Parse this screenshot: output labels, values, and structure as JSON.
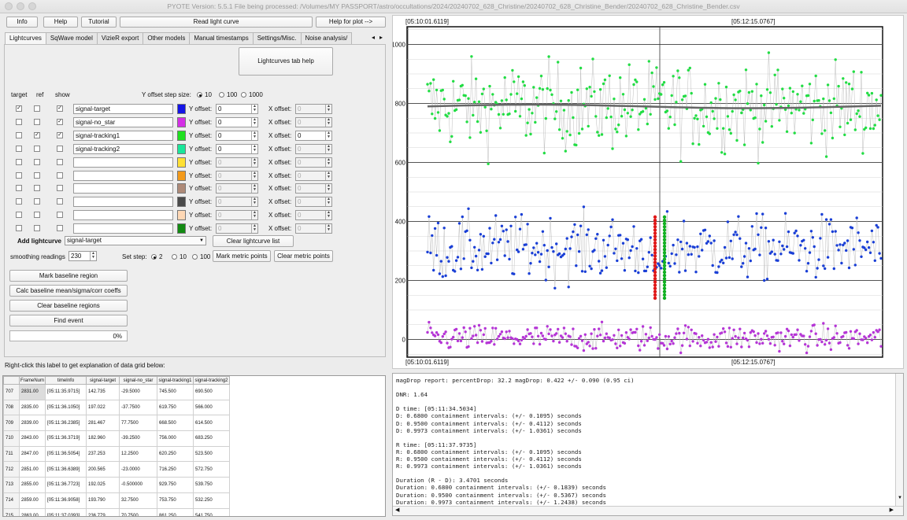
{
  "window": {
    "title": "PYOTE Version: 5.5.1  File being processed: /Volumes/MY PASSPORT/astro/occultations/2024/20240702_628_Christine/20240702_628_Christine_Bender/20240702_628_Christine_Bender.csv"
  },
  "toolbar": {
    "info": "Info",
    "help": "Help",
    "tutorial": "Tutorial",
    "read": "Read light curve",
    "help_plot": "Help for plot -->"
  },
  "tabs": [
    "Lightcurves",
    "SqWave model",
    "VizieR export",
    "Other models",
    "Manual timestamps",
    "Settings/Misc.",
    "Noise analysis/"
  ],
  "lc_help": "Lightcurves tab help",
  "columns": {
    "target": "target",
    "ref": "ref",
    "show": "show"
  },
  "yoffset": {
    "label": "Y offset step size:",
    "opts": [
      "10",
      "100",
      "1000"
    ],
    "selected": "10"
  },
  "offset_labels": {
    "y": "Y offset:",
    "x": "X offset:"
  },
  "rows": [
    {
      "name": "signal-target",
      "color": "#1414e6",
      "target": true,
      "ref": false,
      "show": true,
      "y": "0",
      "x": "0"
    },
    {
      "name": "signal-no_star",
      "color": "#d42fe6",
      "target": false,
      "ref": false,
      "show": true,
      "y": "0",
      "x": "0"
    },
    {
      "name": "signal-tracking1",
      "color": "#1fe01f",
      "target": false,
      "ref": true,
      "show": true,
      "y": "0",
      "x": "0"
    },
    {
      "name": "signal-tracking2",
      "color": "#1ae69a",
      "target": false,
      "ref": false,
      "show": false,
      "y": "0",
      "x": "0"
    },
    {
      "name": "",
      "color": "#ffe033",
      "target": false,
      "ref": false,
      "show": false,
      "y": "0",
      "x": "0"
    },
    {
      "name": "",
      "color": "#f39a1a",
      "target": false,
      "ref": false,
      "show": false,
      "y": "0",
      "x": "0"
    },
    {
      "name": "",
      "color": "#ae8a78",
      "target": false,
      "ref": false,
      "show": false,
      "y": "0",
      "x": "0"
    },
    {
      "name": "",
      "color": "#4a4a4a",
      "target": false,
      "ref": false,
      "show": false,
      "y": "0",
      "x": "0"
    },
    {
      "name": "",
      "color": "#ffd8b5",
      "target": false,
      "ref": false,
      "show": false,
      "y": "0",
      "x": "0"
    },
    {
      "name": "",
      "color": "#128a12",
      "target": false,
      "ref": false,
      "show": false,
      "y": "0",
      "x": "0"
    }
  ],
  "add_lc": {
    "label": "Add lightcurve",
    "value": "signal-target",
    "clear": "Clear lightcurve list"
  },
  "smoothing": {
    "label": "smoothing readings",
    "value": "230"
  },
  "setstep": {
    "label": "Set step:",
    "opts": [
      "2",
      "10",
      "100"
    ],
    "selected": "2"
  },
  "metric": {
    "mark": "Mark metric points",
    "clear": "Clear metric points"
  },
  "actions": {
    "mark_baseline": "Mark baseline region",
    "calc_baseline": "Calc baseline mean/sigma/corr coeffs",
    "clear_baseline": "Clear baseline regions",
    "find_event": "Find event"
  },
  "progress": {
    "text": "0%",
    "fraction": 0
  },
  "grid_hint": "Right-click this label to get explanation of data grid below:",
  "grid": {
    "headers": [
      "FrameNum",
      "timeInfo",
      "signal-target",
      "signal-no_star",
      "signal-tracking1",
      "signal-tracking2"
    ],
    "rows": [
      {
        "idx": "707",
        "cells": [
          "2831.00",
          "[05:11:35.9715]",
          "142.735",
          "-29.5000",
          "745.500",
          "690.500"
        ]
      },
      {
        "idx": "708",
        "cells": [
          "2835.00",
          "[05:11:36.1050]",
          "197.022",
          "-37.7500",
          "619.750",
          "566.000"
        ]
      },
      {
        "idx": "709",
        "cells": [
          "2839.00",
          "[05:11:36.2385]",
          "281.467",
          "77.7500",
          "668.500",
          "614.500"
        ]
      },
      {
        "idx": "710",
        "cells": [
          "2843.00",
          "[05:11:36.3719]",
          "182.960",
          "-39.2500",
          "756.000",
          "683.250"
        ]
      },
      {
        "idx": "711",
        "cells": [
          "2847.00",
          "[05:11:36.5054]",
          "237.253",
          "12.2500",
          "620.250",
          "523.500"
        ]
      },
      {
        "idx": "712",
        "cells": [
          "2851.00",
          "[05:11:36.6389]",
          "200.565",
          "-23.0000",
          "716.250",
          "572.750"
        ]
      },
      {
        "idx": "713",
        "cells": [
          "2855.00",
          "[05:11:36.7723]",
          "192.025",
          "-0.500000",
          "929.750",
          "539.750"
        ]
      },
      {
        "idx": "714",
        "cells": [
          "2859.00",
          "[05:11:36.9058]",
          "193.790",
          "32.7500",
          "753.750",
          "532.250"
        ]
      },
      {
        "idx": "715",
        "cells": [
          "2863.00",
          "[05:11:37.0393]",
          "236.779",
          "70.7500",
          "861.250",
          "541.750"
        ]
      }
    ]
  },
  "plot": {
    "time_start": "[05:10:01.6119]",
    "time_mid": "[05:12:15.0767]",
    "y_ticks": [
      "1000",
      "800",
      "600",
      "400",
      "200",
      "0"
    ]
  },
  "report": [
    "magDrop report: percentDrop: 32.2 magDrop: 0.422 +/- 0.090 (0.95 ci)",
    "",
    "DNR: 1.64",
    "",
    "D time: [05:11:34.5034]",
    "D: 0.6800 containment intervals: (+/- 0.1095) seconds",
    "D: 0.9500 containment intervals: (+/- 0.4112) seconds",
    "D: 0.9973 containment intervals: (+/- 1.0361) seconds",
    "",
    "R time: [05:11:37.9735]",
    "R: 0.6800 containment intervals: (+/- 0.1095) seconds",
    "R: 0.9500 containment intervals: (+/- 0.4112) seconds",
    "R: 0.9973 containment intervals: (+/- 1.0361) seconds",
    "",
    "Duration (R - D): 3.4701 seconds",
    "Duration: 0.6800 containment intervals: (+/- 0.1839) seconds",
    "Duration: 0.9500 containment intervals: (+/- 0.5367) seconds",
    "Duration: 0.9973 containment intervals: (+/- 1.2438) seconds"
  ],
  "chart_data": {
    "type": "scatter",
    "x_ticks": [
      "[05:10:01.6119]",
      "[05:12:15.0767]"
    ],
    "y_ticks": [
      0,
      200,
      400,
      600,
      800,
      1000
    ],
    "ylim": [
      -60,
      1060
    ],
    "grid": true,
    "series": [
      {
        "name": "signal-tracking1",
        "color": "#22dd44",
        "baseline": 790
      },
      {
        "name": "signal-target",
        "color": "#1a3fd6",
        "baseline": 310
      },
      {
        "name": "signal-no_star",
        "color": "#b535d6",
        "baseline": 5
      }
    ],
    "event": {
      "d_color": "#e01818",
      "r_color": "#10b020",
      "bottom": 140
    }
  }
}
